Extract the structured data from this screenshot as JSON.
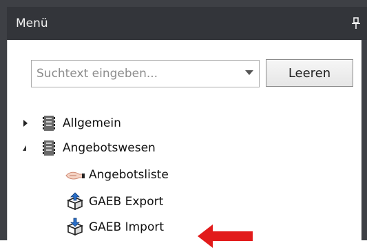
{
  "panel": {
    "title": "Menü"
  },
  "search": {
    "placeholder": "Suchtext eingeben...",
    "value": "",
    "clear_label": "Leeren"
  },
  "tree": {
    "allgemein": {
      "label": "Allgemein",
      "expanded": false
    },
    "angebotswesen": {
      "label": "Angebotswesen",
      "expanded": true,
      "children": [
        {
          "label": "Angebotsliste",
          "icon": "handshake-icon"
        },
        {
          "label": "GAEB Export",
          "icon": "box-export-icon"
        },
        {
          "label": "GAEB Import",
          "icon": "box-import-icon"
        }
      ]
    }
  },
  "colors": {
    "header_bg": "#33353a",
    "frame": "#3e4045",
    "arrow": "#e21b1b"
  }
}
